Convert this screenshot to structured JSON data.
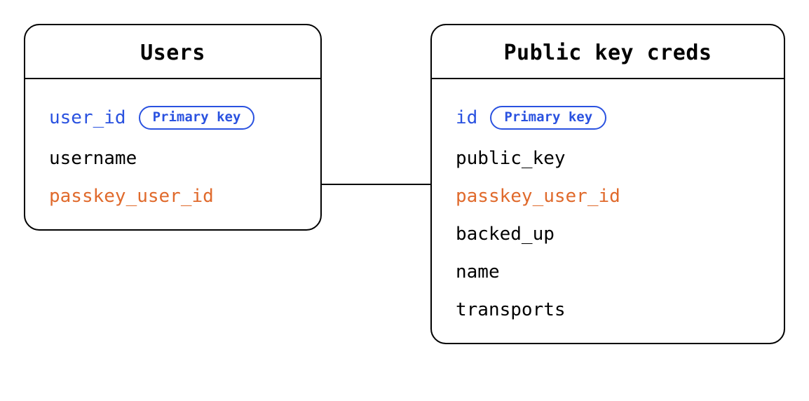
{
  "entities": {
    "users": {
      "title": "Users",
      "fields": [
        {
          "name": "user_id",
          "kind": "pk",
          "badge": "Primary key"
        },
        {
          "name": "username",
          "kind": "normal"
        },
        {
          "name": "passkey_user_id",
          "kind": "fk"
        }
      ]
    },
    "creds": {
      "title": "Public key creds",
      "fields": [
        {
          "name": "id",
          "kind": "pk",
          "badge": "Primary key"
        },
        {
          "name": "public_key",
          "kind": "normal"
        },
        {
          "name": "passkey_user_id",
          "kind": "fk"
        },
        {
          "name": "backed_up",
          "kind": "normal"
        },
        {
          "name": "name",
          "kind": "normal"
        },
        {
          "name": "transports",
          "kind": "normal"
        }
      ]
    }
  },
  "relations": [
    {
      "from": "users.passkey_user_id",
      "to": "creds.passkey_user_id"
    }
  ]
}
